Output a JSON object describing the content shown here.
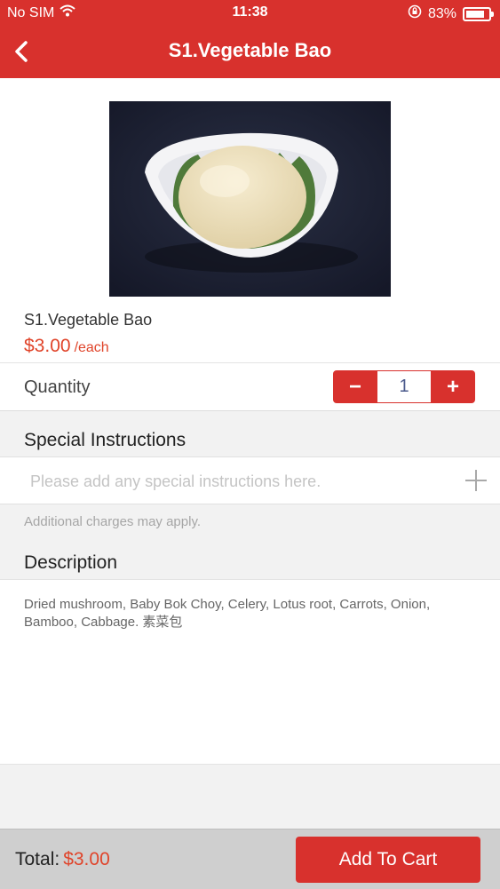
{
  "status": {
    "carrier": "No SIM",
    "time": "11:38",
    "battery": "83%",
    "battery_level": 0.83
  },
  "nav": {
    "title": "S1.Vegetable Bao"
  },
  "item": {
    "name": "S1.Vegetable Bao",
    "price": "$3.00",
    "unit": "/each"
  },
  "quantity": {
    "label": "Quantity",
    "minus": "−",
    "value": "1",
    "plus": "+"
  },
  "instructions": {
    "heading": "Special Instructions",
    "placeholder": "Please add any special instructions here.",
    "value": "",
    "note": "Additional charges may apply."
  },
  "description": {
    "heading": "Description",
    "text": "Dried mushroom, Baby Bok Choy, Celery, Lotus root, Carrots, Onion, Bamboo, Cabbage. 素菜包"
  },
  "footer": {
    "total_label": "Total:",
    "total_value": "$3.00",
    "cart_button": "Add To Cart"
  },
  "colors": {
    "brand": "#d8312d",
    "price": "#e0442a"
  },
  "icons": [
    "wifi-icon",
    "orientation-lock-icon",
    "battery-icon",
    "back-chevron-icon",
    "add-instruction-plus-icon"
  ]
}
